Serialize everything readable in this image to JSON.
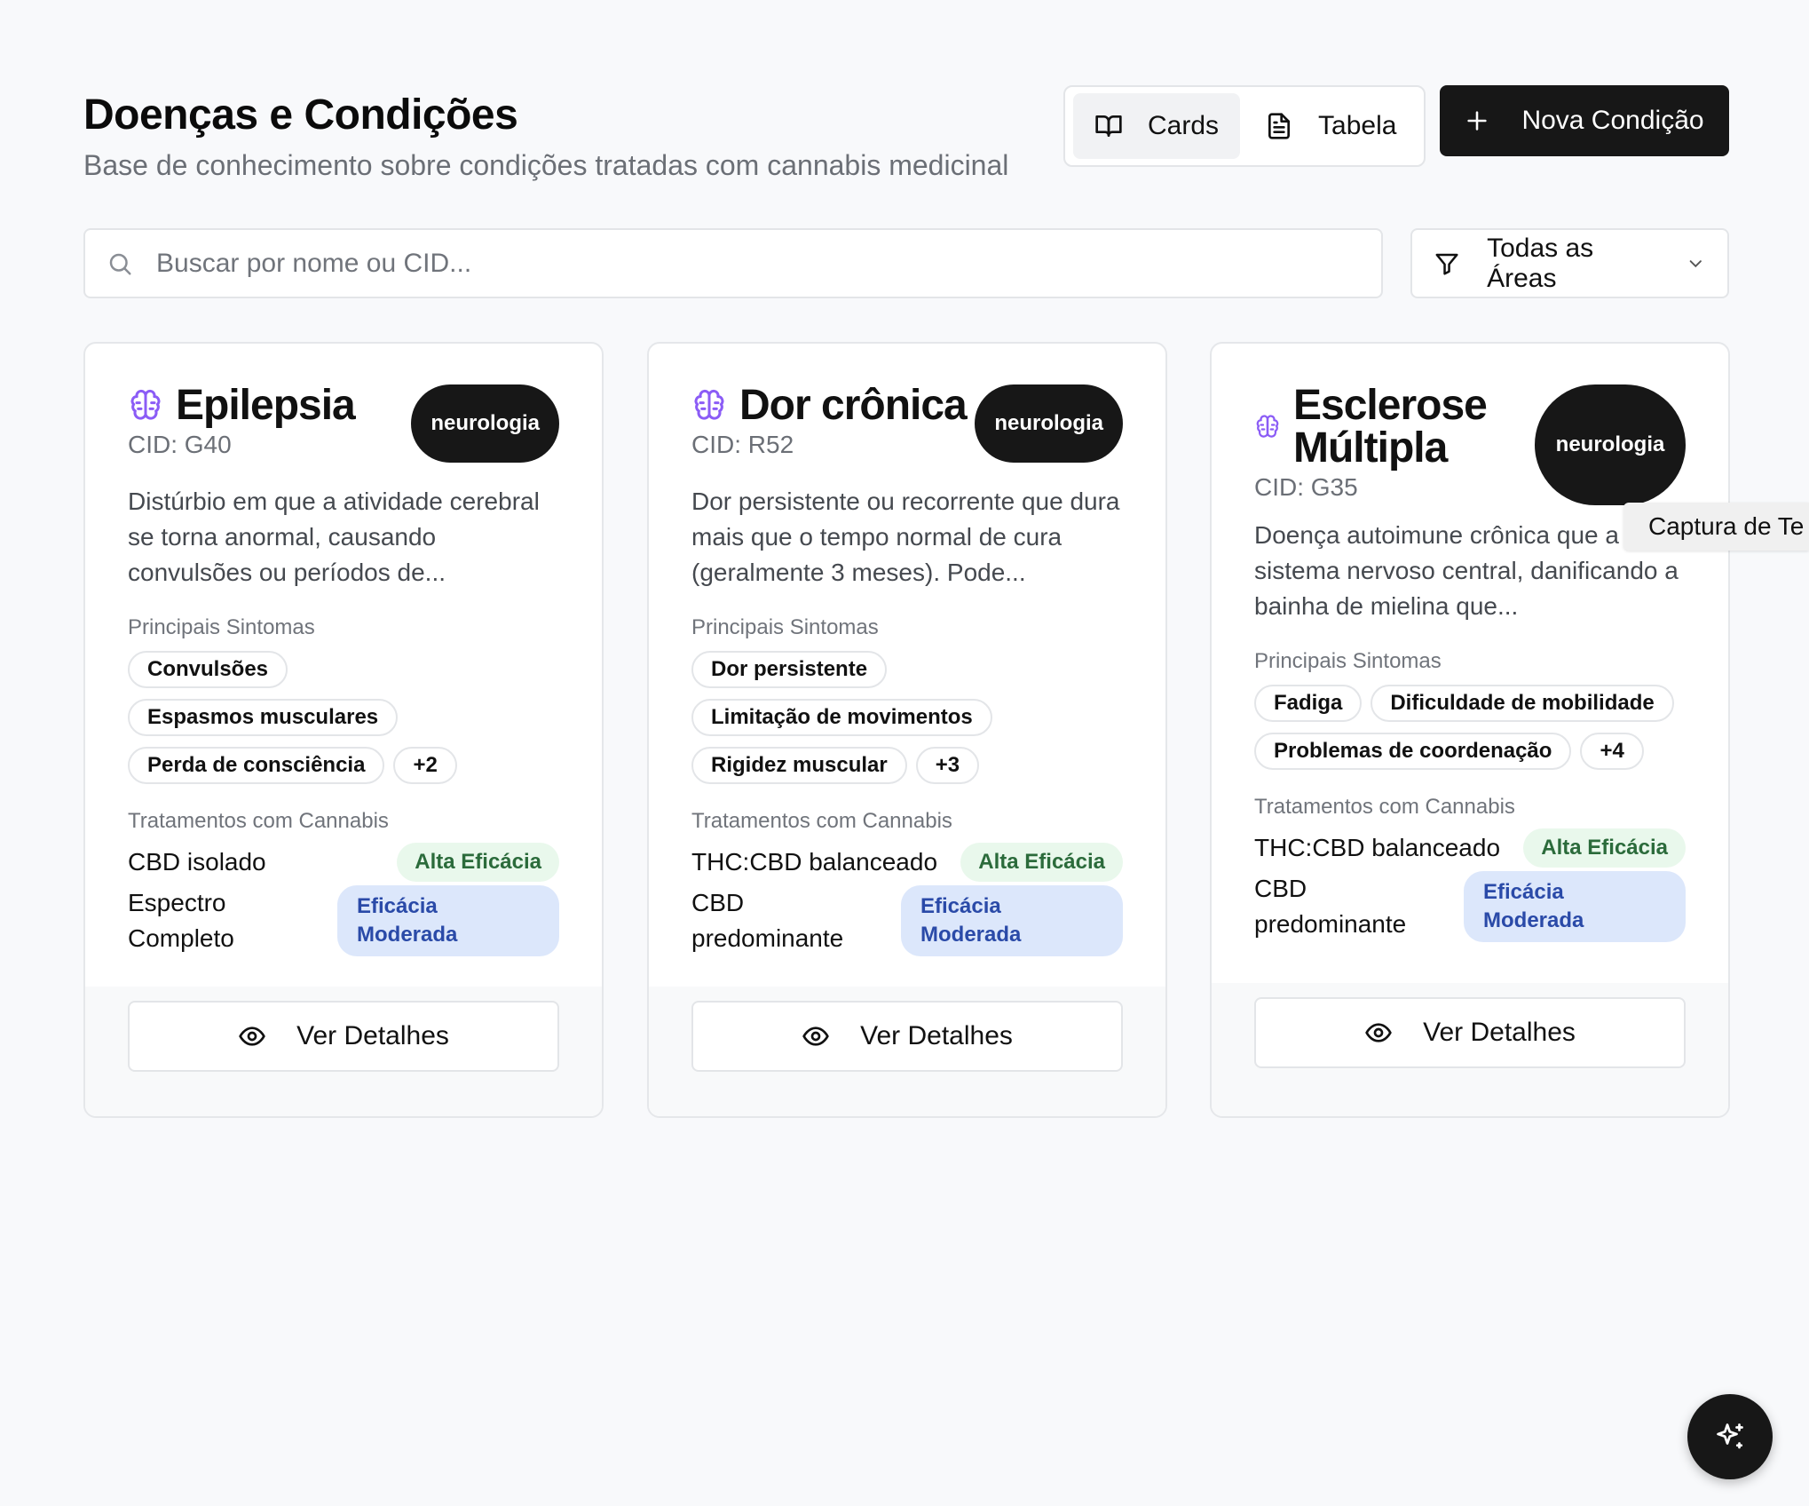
{
  "header": {
    "title": "Doenças e Condições",
    "subtitle": "Base de conhecimento sobre condições tratadas com cannabis medicinal"
  },
  "view_toggle": {
    "cards_label": "Cards",
    "table_label": "Tabela",
    "active": "Cards"
  },
  "new_button_label": "Nova Condição",
  "search": {
    "placeholder": "Buscar por nome ou CID..."
  },
  "filter": {
    "selected": "Todas as Áreas"
  },
  "labels": {
    "symptoms": "Principais Sintomas",
    "treatments": "Tratamentos com Cannabis",
    "details_button": "Ver Detalhes"
  },
  "cards": [
    {
      "title": "Epilepsia",
      "cid": "CID: G40",
      "area": "neurologia",
      "description": "Distúrbio em que a atividade cerebral se torna anormal, causando convulsões ou períodos de...",
      "symptoms": [
        "Convulsões",
        "Espasmos musculares",
        "Perda de consciência"
      ],
      "more_symptoms": "+2",
      "treatments": [
        {
          "name": "CBD isolado",
          "efficacy": "Alta Eficácia",
          "level": "alta"
        },
        {
          "name": "Espectro Completo",
          "efficacy": "Eficácia Moderada",
          "level": "moderada"
        }
      ]
    },
    {
      "title": "Dor crônica",
      "cid": "CID: R52",
      "area": "neurologia",
      "description": "Dor persistente ou recorrente que dura mais que o tempo normal de cura (geralmente 3 meses). Pode...",
      "symptoms": [
        "Dor persistente",
        "Limitação de movimentos",
        "Rigidez muscular"
      ],
      "more_symptoms": "+3",
      "treatments": [
        {
          "name": "THC:CBD balanceado",
          "efficacy": "Alta Eficácia",
          "level": "alta"
        },
        {
          "name": "CBD predominante",
          "efficacy": "Eficácia Moderada",
          "level": "moderada"
        }
      ]
    },
    {
      "title": "Esclerose Múltipla",
      "cid": "CID: G35",
      "area": "neurologia",
      "description": "Doença autoimune crônica que a o sistema nervoso central, danificando a bainha de mielina que...",
      "symptoms": [
        "Fadiga",
        "Dificuldade de mobilidade",
        "Problemas de coordenação"
      ],
      "more_symptoms": "+4",
      "treatments": [
        {
          "name": "THC:CBD balanceado",
          "efficacy": "Alta Eficácia",
          "level": "alta"
        },
        {
          "name": "CBD predominante",
          "efficacy": "Eficácia Moderada",
          "level": "moderada"
        }
      ]
    }
  ],
  "tooltip": "Captura de Te",
  "colors": {
    "primary": "#171717",
    "brain_icon": "#8b5cf6",
    "alta_bg": "#e9f8ec",
    "alta_text": "#2b6b3b",
    "moderada_bg": "#dce7fb",
    "moderada_text": "#2a4aa8",
    "background": "#f8f9fb"
  },
  "icons": {
    "cards": "book-open-icon",
    "table": "file-text-icon",
    "new": "plus-icon",
    "search": "search-icon",
    "filter": "filter-icon",
    "dropdown": "chevron-down-icon",
    "card": "brain-icon",
    "details": "eye-icon",
    "fab": "sparkles-icon"
  }
}
